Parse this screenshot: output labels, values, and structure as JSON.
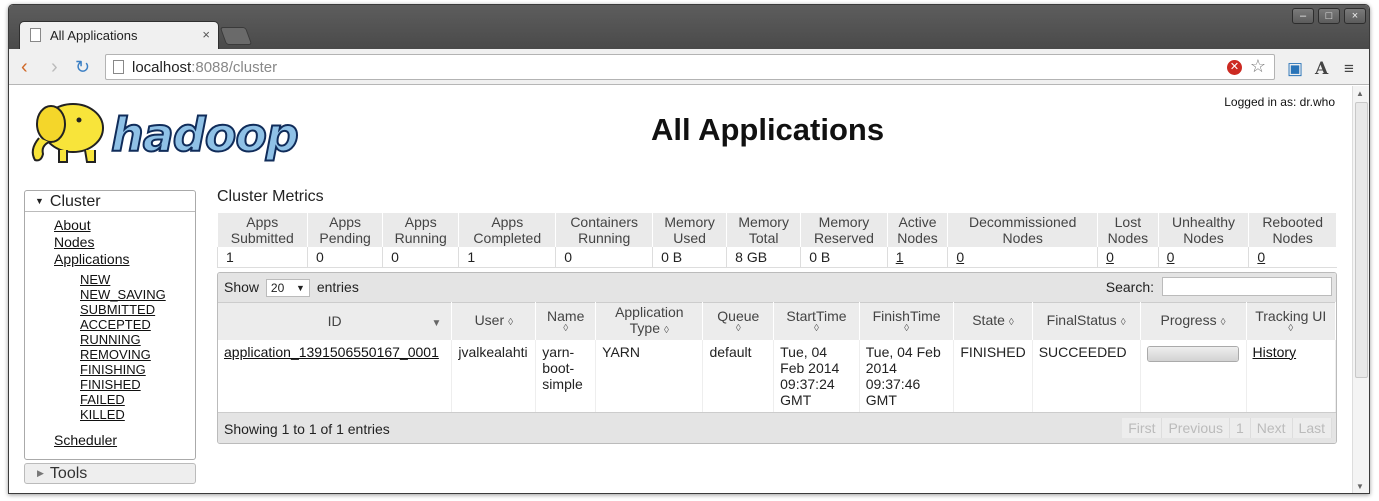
{
  "browser": {
    "tab_title": "All Applications",
    "tab_close": "×",
    "url_host": "localhost",
    "url_rest": ":8088/cluster",
    "window_controls": [
      "–",
      "□",
      "×"
    ]
  },
  "header": {
    "logo_text": "hadoop",
    "page_title": "All Applications",
    "logged_in": "Logged in as: dr.who"
  },
  "nav": {
    "cluster_label": "Cluster",
    "items": [
      "About",
      "Nodes",
      "Applications"
    ],
    "app_states": [
      "NEW",
      "NEW_SAVING",
      "SUBMITTED",
      "ACCEPTED",
      "RUNNING",
      "REMOVING",
      "FINISHING",
      "FINISHED",
      "FAILED",
      "KILLED"
    ],
    "scheduler": "Scheduler",
    "tools_label": "Tools"
  },
  "metrics": {
    "label": "Cluster Metrics",
    "headers": [
      [
        "Apps",
        "Submitted"
      ],
      [
        "Apps",
        "Pending"
      ],
      [
        "Apps",
        "Running"
      ],
      [
        "Apps",
        "Completed"
      ],
      [
        "Containers",
        "Running"
      ],
      [
        "Memory",
        "Used"
      ],
      [
        "Memory",
        "Total"
      ],
      [
        "Memory",
        "Reserved"
      ],
      [
        "Active",
        "Nodes"
      ],
      [
        "Decommissioned",
        "Nodes"
      ],
      [
        "Lost",
        "Nodes"
      ],
      [
        "Unhealthy",
        "Nodes"
      ],
      [
        "Rebooted",
        "Nodes"
      ]
    ],
    "values": [
      "1",
      "0",
      "0",
      "1",
      "0",
      "0 B",
      "8 GB",
      "0 B",
      "1",
      "0",
      "0",
      "0",
      "0"
    ]
  },
  "apps": {
    "show_label": "Show",
    "entries_value": "20",
    "entries_label": "entries",
    "search_label": "Search:",
    "columns": [
      "ID",
      "User",
      "Name",
      "Application Type",
      "Queue",
      "StartTime",
      "FinishTime",
      "State",
      "FinalStatus",
      "Progress",
      "Tracking UI"
    ],
    "rows": [
      {
        "id": "application_1391506550167_0001",
        "user": "jvalkealahti",
        "name": "yarn-boot-simple",
        "type": "YARN",
        "queue": "default",
        "start": "Tue, 04 Feb 2014 09:37:24 GMT",
        "finish": "Tue, 04 Feb 2014 09:37:46 GMT",
        "state": "FINISHED",
        "final_status": "SUCCEEDED",
        "tracking": "History"
      }
    ],
    "info": "Showing 1 to 1 of 1 entries",
    "pager": [
      "First",
      "Previous",
      "1",
      "Next",
      "Last"
    ]
  }
}
